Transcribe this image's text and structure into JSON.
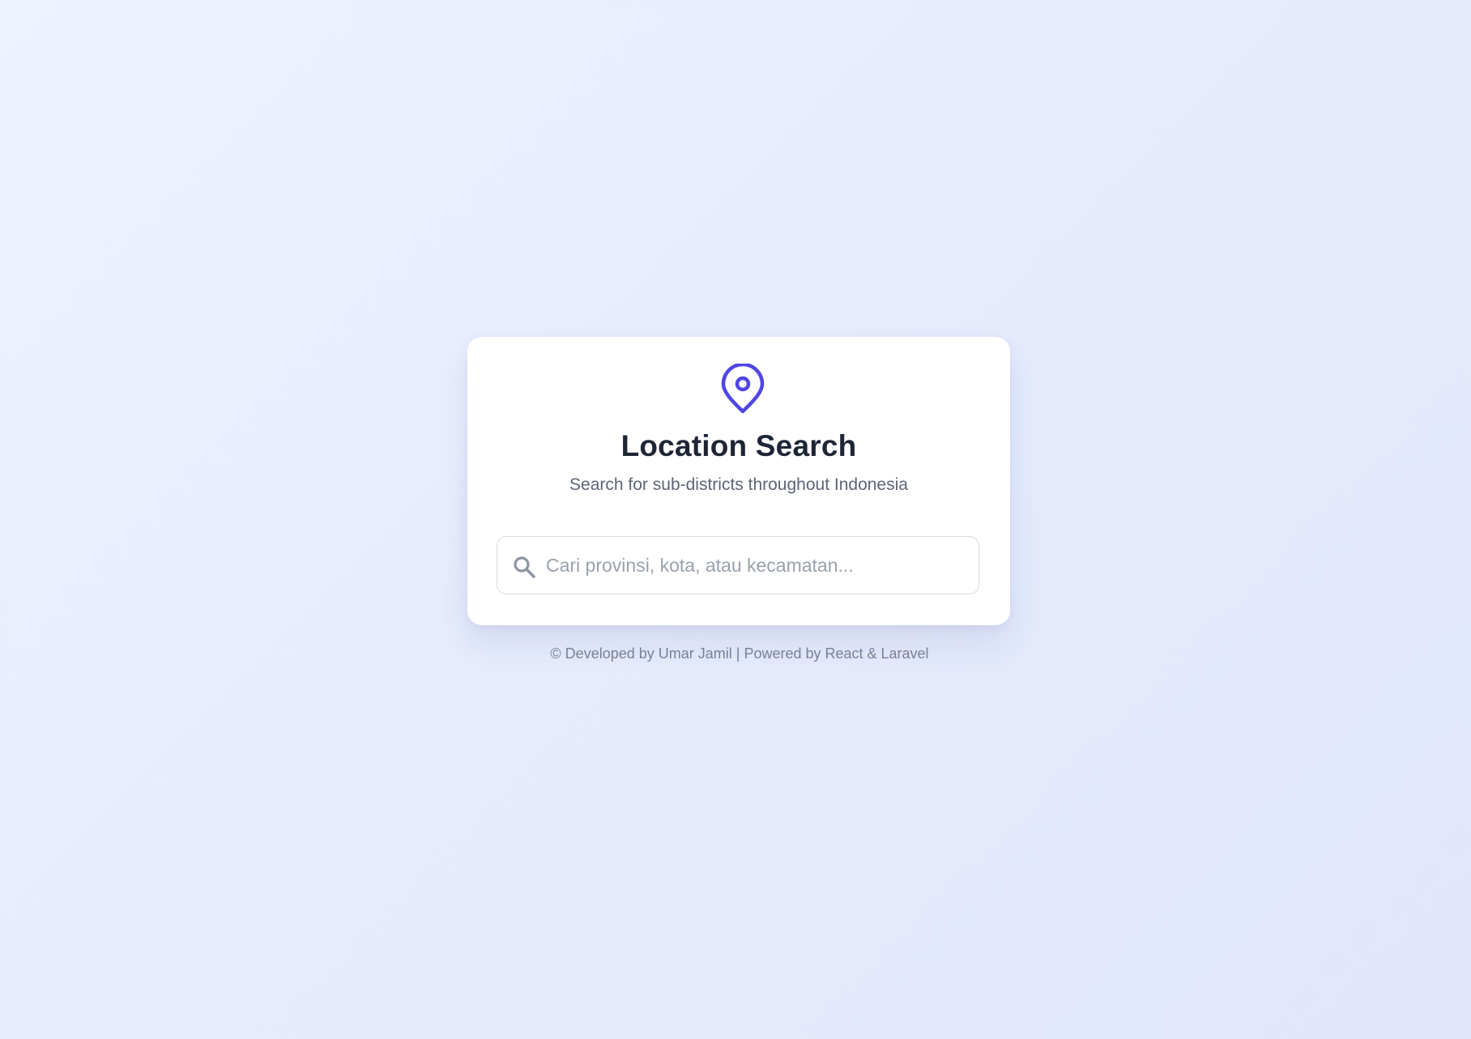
{
  "card": {
    "icon": "map-pin-icon",
    "title": "Location Search",
    "subtitle": "Search for sub-districts throughout Indonesia",
    "accent_color": "#4f46e5"
  },
  "search": {
    "icon": "search-icon",
    "placeholder": "Cari provinsi, kota, atau kecamatan...",
    "value": ""
  },
  "footer": {
    "text": "© Developed by Umar Jamil | Powered by React & Laravel"
  }
}
